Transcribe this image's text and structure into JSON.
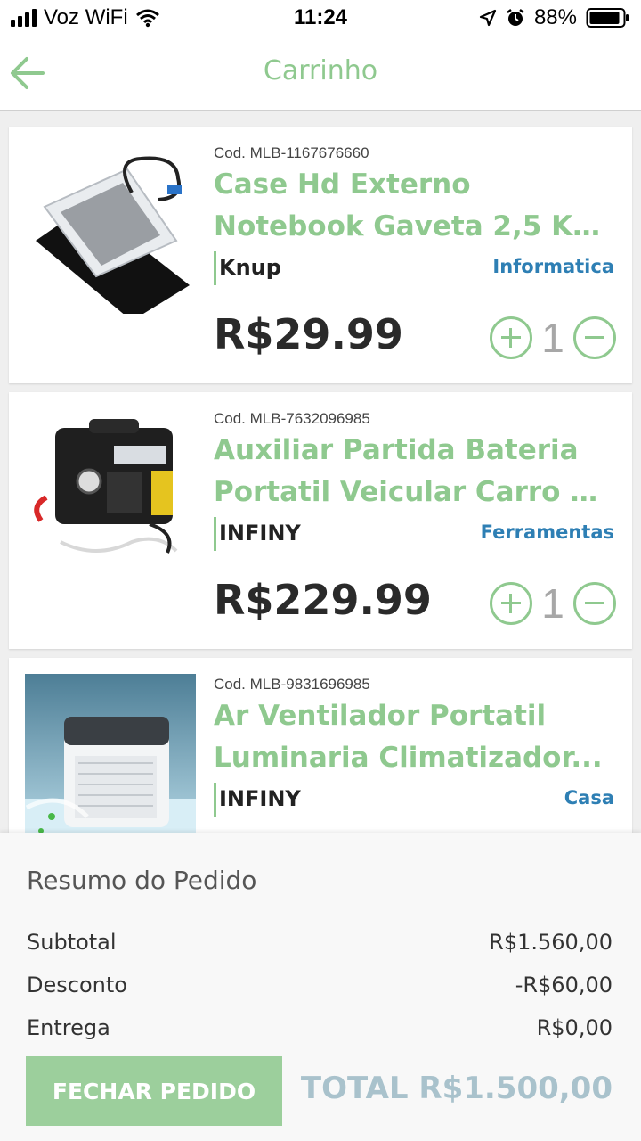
{
  "status_bar": {
    "carrier": "Voz WiFi",
    "time": "11:24",
    "battery": "88%"
  },
  "header": {
    "title": "Carrinho"
  },
  "colors": {
    "accent": "#8fc98f",
    "category": "#2e7fb4",
    "total": "#a9c2cc",
    "button": "#9ccf9c"
  },
  "cart": {
    "items": [
      {
        "code": "Cod. MLB-1167676660",
        "title_line1": "Case Hd Externo",
        "title_line2": "Notebook Gaveta 2,5 Kp...",
        "brand": "Knup",
        "category": "Informatica",
        "price": "R$29.99",
        "quantity": "1"
      },
      {
        "code": "Cod. MLB-7632096985",
        "title_line1": "Auxiliar Partida Bateria",
        "title_line2": "Portatil Veicular Carro E...",
        "brand": "INFINY",
        "category": "Ferramentas",
        "price": "R$229.99",
        "quantity": "1"
      },
      {
        "code": "Cod. MLB-9831696985",
        "title_line1": "Ar Ventilador Portatil",
        "title_line2": "Luminaria Climatizador...",
        "brand": "INFINY",
        "category": "Casa",
        "price": "",
        "quantity": ""
      }
    ]
  },
  "summary": {
    "title": "Resumo do Pedido",
    "subtotal_label": "Subtotal",
    "subtotal_value": "R$1.560,00",
    "discount_label": "Desconto",
    "discount_value": "-R$60,00",
    "delivery_label": "Entrega",
    "delivery_value": "R$0,00",
    "checkout_label": "FECHAR PEDIDO",
    "total": "TOTAL R$1.500,00"
  }
}
